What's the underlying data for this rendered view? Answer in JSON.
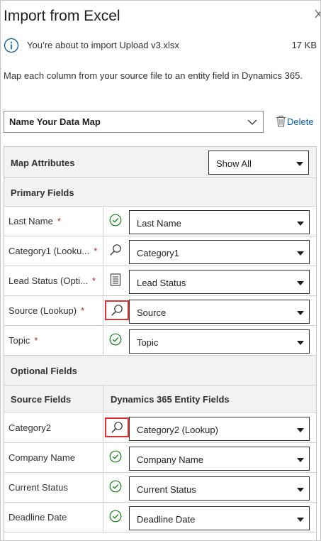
{
  "panel": {
    "title": "Import from Excel",
    "close_icon": "close-icon"
  },
  "info": {
    "message": "You’re about to import Upload v3.xlsx",
    "size": "17 KB"
  },
  "description": "Map each column from your source file to an entity field in Dynamics 365.",
  "data_map": {
    "value": "Name Your Data Map",
    "delete_label": "Delete"
  },
  "grid": {
    "header_label": "Map Attributes",
    "filter_value": "Show All",
    "primary_label": "Primary Fields",
    "optional_label": "Optional Fields",
    "source_col": "Source Fields",
    "target_col": "Dynamics 365 Entity Fields",
    "primary": [
      {
        "source": "Last Name",
        "required": true,
        "icon": "check-icon",
        "target": "Last Name"
      },
      {
        "source": "Category1 (Looku...",
        "required": true,
        "icon": "lookup-icon",
        "target": "Category1"
      },
      {
        "source": "Lead Status (Opti...",
        "required": true,
        "icon": "list-icon",
        "target": "Lead Status"
      },
      {
        "source": "Source (Lookup)",
        "required": true,
        "icon": "lookup-icon",
        "highlight": true,
        "target": "Source"
      },
      {
        "source": "Topic",
        "required": true,
        "icon": "check-icon",
        "target": "Topic"
      }
    ],
    "optional": [
      {
        "source": "Category2",
        "icon": "lookup-icon",
        "highlight": true,
        "target": "Category2 (Lookup)"
      },
      {
        "source": "Company Name",
        "icon": "check-icon",
        "target": "Company Name"
      },
      {
        "source": "Current Status",
        "icon": "check-icon",
        "target": "Current Status"
      },
      {
        "source": "Deadline Date",
        "icon": "check-icon",
        "target": "Deadline Date"
      }
    ],
    "required_marker": "*"
  },
  "colors": {
    "check": "#107c10",
    "link": "#005a9e",
    "required": "#a4262c",
    "highlight": "#e03131"
  }
}
